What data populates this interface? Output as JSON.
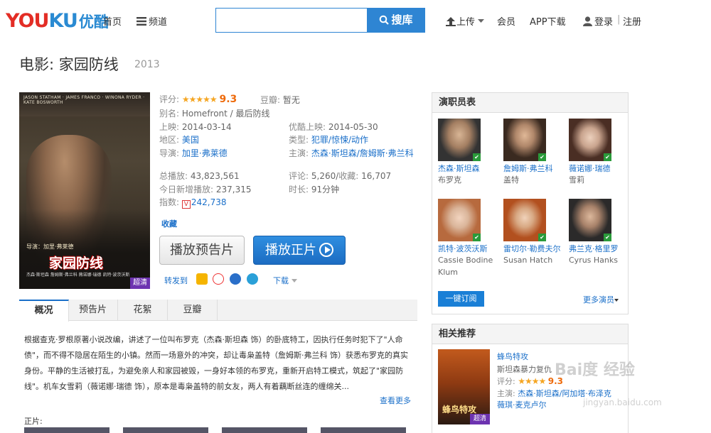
{
  "header": {
    "logo_en": "YOUKU",
    "logo_cn": "优酷",
    "nav_home": "首页",
    "nav_channels": "频道",
    "search_placeholder": "",
    "search_btn": "搜库",
    "upload": "上传",
    "member": "会员",
    "app": "APP下载",
    "login": "登录",
    "sep": "|",
    "register": "注册"
  },
  "movie": {
    "title": "电影: 家园防线",
    "year": "2013",
    "poster": {
      "actors": "JASON STATHAM · JAMES FRANCO · WINONA RYDER · KATE BOSWORTH",
      "title": "家园防线",
      "tagline": "导演：加里·弗莱德",
      "footer": "杰森·斯坦森 詹姆斯·弗兰科 薇诺娜·瑞德 凯特·波茨沃斯",
      "hd_badge": "超清"
    },
    "rating_label": "评分:",
    "stars": "★★★★★",
    "score": "9.3",
    "douban_label": "豆瓣:",
    "douban_value": "暂无",
    "alias_label": "别名:",
    "alias_value": "Homefront / 最后防线",
    "release_label": "上映:",
    "release_value": "2014-03-14",
    "youku_release_label": "优酷上映:",
    "youku_release_value": "2014-05-30",
    "region_label": "地区:",
    "region_value": "美国",
    "genre_label": "类型:",
    "genre_1": "犯罪",
    "genre_2": "惊悚",
    "genre_3": "动作",
    "director_label": "导演:",
    "director_value": "加里·弗莱德",
    "stars_label": "主演:",
    "star_1": "杰森·斯坦森",
    "star_2": "詹姆斯·弗兰科",
    "plays_label": "总播放:",
    "plays_value": "43,823,561",
    "comments_label": "评论:",
    "comments_value": "5,260",
    "fav_label": "收藏:",
    "fav_value": "16,707",
    "today_label": "今日新增播放:",
    "today_value": "237,315",
    "duration_label": "时长:",
    "duration_value": "91分钟",
    "index_label": "指数:",
    "index_badge": "V",
    "index_value": "242,738",
    "favorite_btn": "收藏",
    "trailer_btn": "播放预告片",
    "play_btn": "播放正片",
    "share_label": "转发到",
    "download_label": "下载"
  },
  "tabs": [
    "概况",
    "预告片",
    "花絮",
    "豆瓣"
  ],
  "description": "根据查克·罗根原著小说改编，讲述了一位叫布罗克（杰森·斯坦森 饰）的卧底特工，因执行任务时犯下了\"人命债\"，而不得不隐居在陌生的小镇。然而一场意外的冲突，却让毒枭盖特（詹姆斯·弗兰科 饰）获悉布罗克的真实身份。平静的生活被打乱，为避免亲人和家园被毁，一身好本领的布罗克，重新开启特工模式，筑起了\"家园防线\"。机车女雪莉（薇诺娜·瑞德 饰），原本是毒枭盖特的前女友，两人有着藕断丝连的缠绵关...",
  "more_link": "查看更多",
  "episodes_label": "正片:",
  "cast_panel": {
    "title": "演职员表",
    "members": [
      {
        "name": "杰森·斯坦森",
        "role": "布罗克"
      },
      {
        "name": "詹姆斯·弗兰科",
        "role": "盖特"
      },
      {
        "name": "薇诺娜·瑞德",
        "role": "雪莉"
      },
      {
        "name": "凯特·波茨沃斯",
        "role": "Cassie Bodine Klum"
      },
      {
        "name": "雷切尔·勒费夫尔",
        "role": "Susan Hatch"
      },
      {
        "name": "弗兰克·格里罗",
        "role": "Cyrus Hanks"
      }
    ],
    "subscribe_btn": "一键订阅",
    "more_cast": "更多演员"
  },
  "rec_panel": {
    "title": "相关推荐",
    "item_title": "蜂鸟特攻",
    "item_desc": "斯坦森暴力复仇",
    "item_rating_label": "评分:",
    "item_stars": "★★★★",
    "item_score": "9.3",
    "item_stars_label": "主演:",
    "item_star_1": "杰森·斯坦森",
    "item_star_2": "阿加塔·布泽克",
    "item_star_3": "薇琪·麦克卢尔",
    "poster_text": "蜂鸟特攻",
    "hd_badge": "超清"
  },
  "watermark": "Bai度 经验",
  "watermark_url": "jingyan.baidu.com",
  "colors": {
    "accent": "#2e85d3",
    "score": "#ee6b0c",
    "link": "#1a6fc9"
  }
}
